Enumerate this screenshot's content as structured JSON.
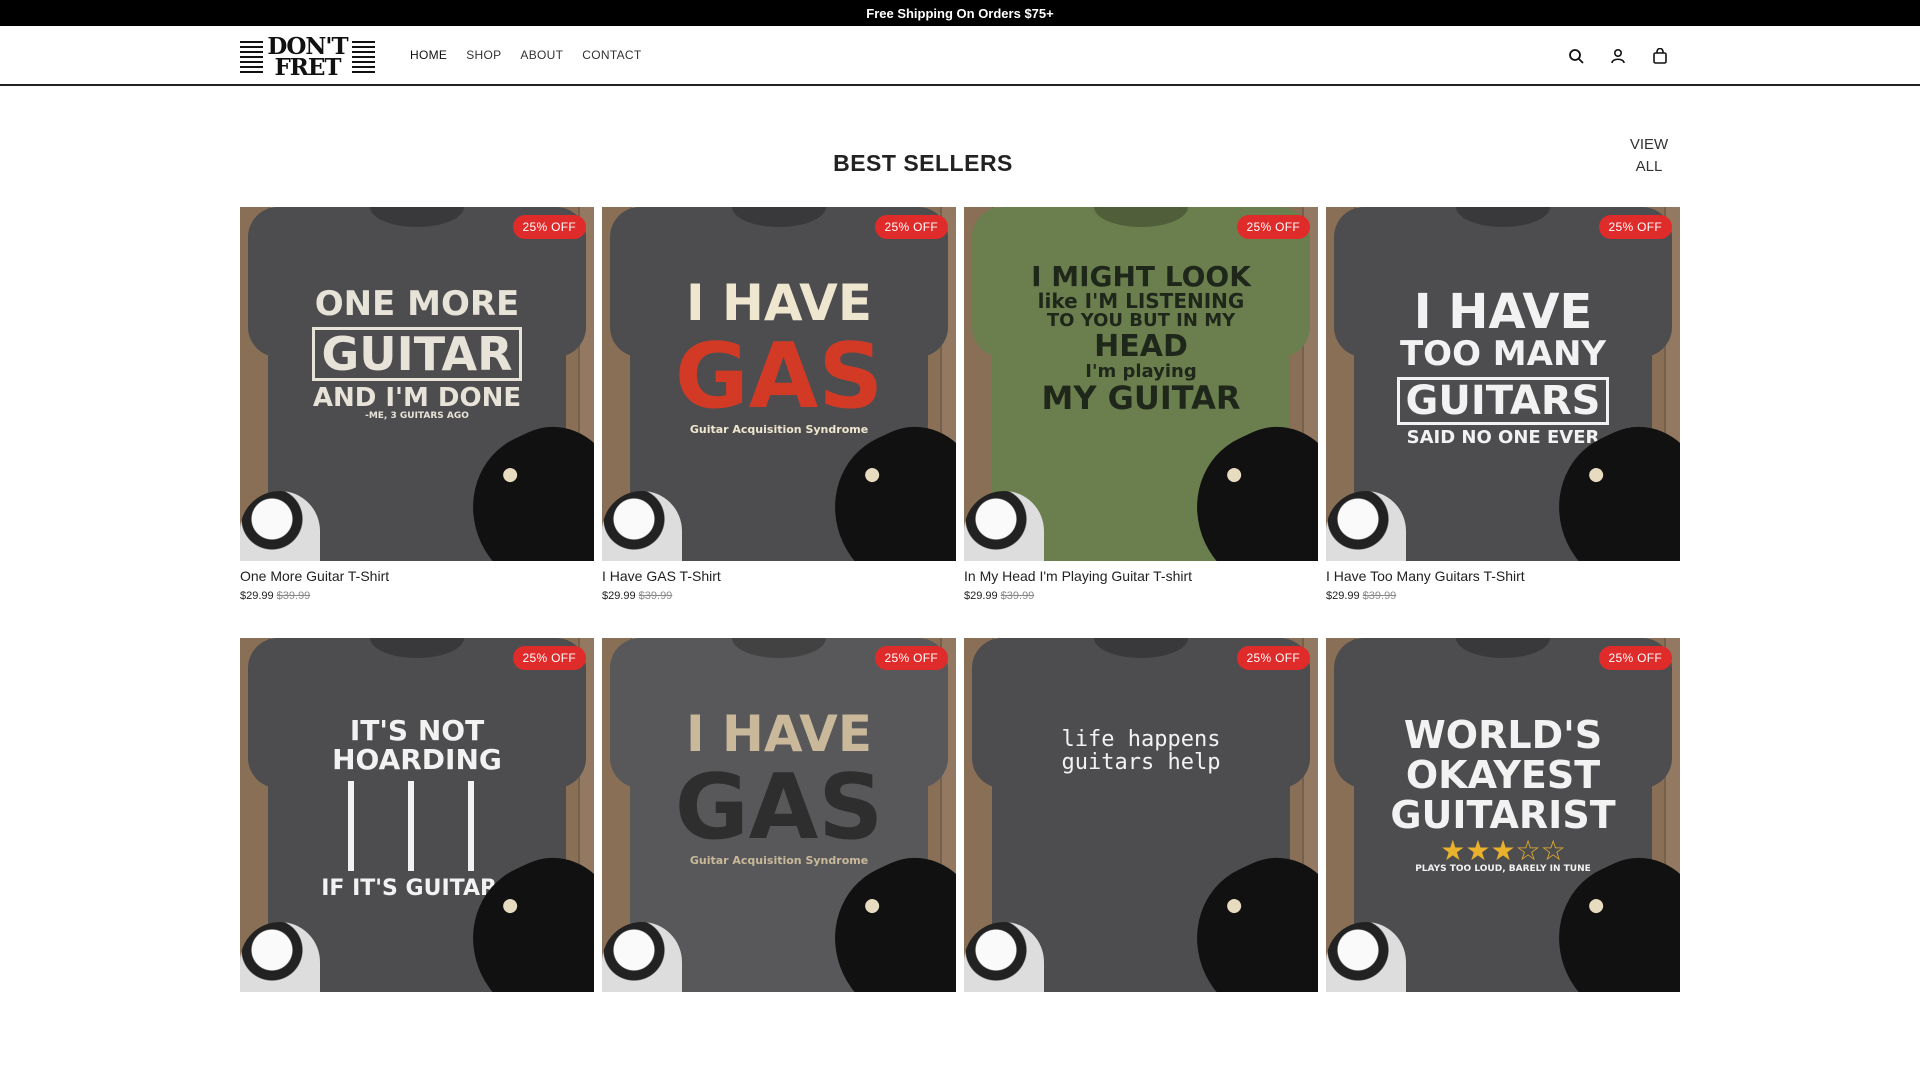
{
  "announcement": "Free Shipping On Orders $75+",
  "logo": {
    "line1": "DON'T",
    "line2": "FRET"
  },
  "nav": [
    {
      "label": "HOME"
    },
    {
      "label": "SHOP"
    },
    {
      "label": "ABOUT"
    },
    {
      "label": "CONTACT"
    }
  ],
  "header_icons": [
    "search-icon",
    "account-icon",
    "cart-icon"
  ],
  "section": {
    "title": "BEST SELLERS",
    "view_all_line1": "VIEW",
    "view_all_line2": "ALL"
  },
  "products": [
    {
      "title": "One More Guitar T-Shirt",
      "price": "$29.99",
      "compare": "$39.99",
      "badge": "25% OFF",
      "shirt_color": "#4d4d4f",
      "ink": "#e8e3d8",
      "accent": "#e8e3d8",
      "art": [
        "ONE MORE",
        "GUITAR",
        "AND I'M DONE",
        "-ME, 3 GUITARS AGO"
      ]
    },
    {
      "title": "I Have GAS T-Shirt",
      "price": "$29.99",
      "compare": "$39.99",
      "badge": "25% OFF",
      "shirt_color": "#4d4d4f",
      "ink": "#efe6cf",
      "accent": "#d23a26",
      "art": [
        "I HAVE",
        "GAS",
        "Guitar Acquisition Syndrome"
      ]
    },
    {
      "title": "In My Head I'm Playing Guitar T-shirt",
      "price": "$29.99",
      "compare": "$39.99",
      "badge": "25% OFF",
      "shirt_color": "#6b7f4e",
      "ink": "#1f261a",
      "accent": "#1f261a",
      "art": [
        "I MIGHT LOOK",
        "like I'M LISTENING",
        "TO YOU BUT IN MY",
        "HEAD",
        "I'm playing",
        "MY GUITAR"
      ]
    },
    {
      "title": "I Have Too Many Guitars T-Shirt",
      "price": "$29.99",
      "compare": "$39.99",
      "badge": "25% OFF",
      "shirt_color": "#4d4d4f",
      "ink": "#f2f2f2",
      "accent": "#f2f2f2",
      "art": [
        "I HAVE",
        "TOO MANY",
        "GUITARS",
        "SAID NO ONE EVER"
      ]
    },
    {
      "title": "",
      "price": "",
      "compare": "",
      "badge": "25% OFF",
      "shirt_color": "#4d4d4f",
      "ink": "#f2f2f2",
      "accent": "#f2f2f2",
      "art": [
        "IT'S NOT",
        "HOARDING",
        "",
        "IF IT'S GUITARS"
      ]
    },
    {
      "title": "",
      "price": "",
      "compare": "",
      "badge": "25% OFF",
      "shirt_color": "#58585a",
      "ink": "#c9b99a",
      "accent": "#2e2e2e",
      "art": [
        "I HAVE",
        "GAS",
        "Guitar Acquisition Syndrome"
      ]
    },
    {
      "title": "",
      "price": "",
      "compare": "",
      "badge": "25% OFF",
      "shirt_color": "#4d4d4f",
      "ink": "#f2f2f2",
      "accent": "#f2f2f2",
      "art": [
        "life happens",
        "guitars help"
      ]
    },
    {
      "title": "",
      "price": "",
      "compare": "",
      "badge": "25% OFF",
      "shirt_color": "#4d4d4f",
      "ink": "#f2f2f2",
      "accent": "#e9b12c",
      "art": [
        "WORLD'S",
        "OKAYEST",
        "GUITARIST",
        "★★★☆☆",
        "PLAYS TOO LOUD, BARELY IN TUNE"
      ]
    }
  ]
}
